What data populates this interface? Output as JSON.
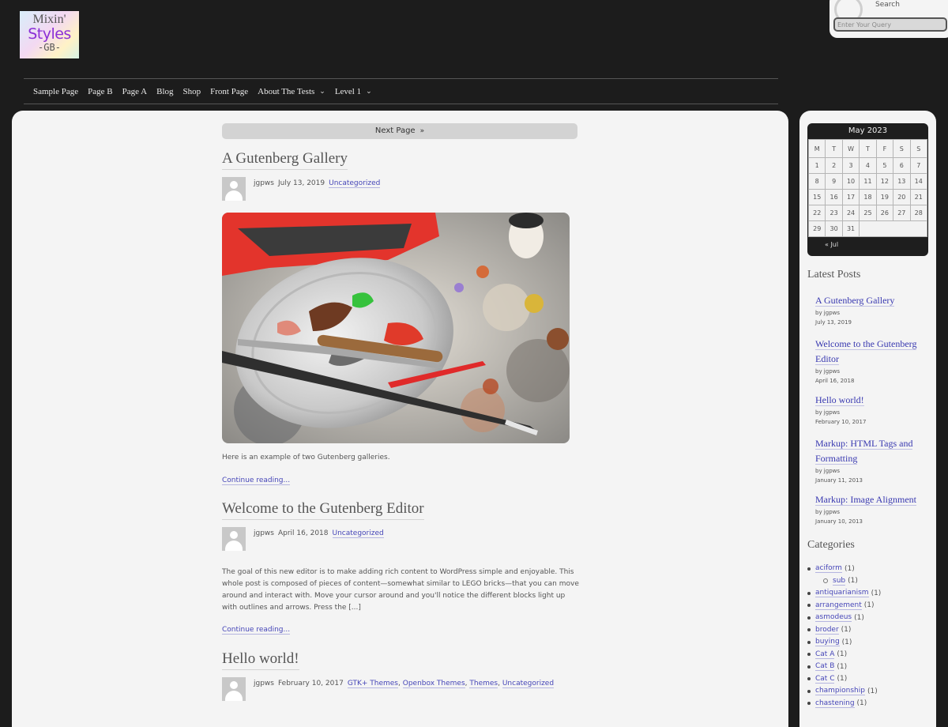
{
  "logo": {
    "line1": "Mixin'",
    "line2": "Styles",
    "line3": "-GB-"
  },
  "search": {
    "label": "Search",
    "placeholder": "Enter Your Query"
  },
  "nav": {
    "items": [
      "Sample Page",
      "Page B",
      "Page A",
      "Blog",
      "Shop",
      "Front Page",
      "About The Tests",
      "Level 1"
    ]
  },
  "pager": {
    "next_label": "Next Page",
    "next_icon": "»"
  },
  "posts": [
    {
      "title": "A Gutenberg Gallery",
      "author": "jgpws",
      "date": "July 13, 2019",
      "categories": [
        "Uncategorized"
      ],
      "excerpt": "Here is an example of two Gutenberg galleries.",
      "continue": "Continue reading..."
    },
    {
      "title": "Welcome to the Gutenberg Editor",
      "author": "jgpws",
      "date": "April 16, 2018",
      "categories": [
        "Uncategorized"
      ],
      "excerpt": "The goal of this new editor is to make adding rich content to WordPress simple and enjoyable. This whole post is composed of pieces of content—somewhat similar to LEGO bricks—that you can move around and interact with. Move your cursor around and you'll notice the different blocks light up with outlines and arrows. Press the [...]",
      "continue": "Continue reading..."
    },
    {
      "title": "Hello world!",
      "author": "jgpws",
      "date": "February 10, 2017",
      "categories": [
        "GTK+ Themes",
        "Openbox Themes",
        "Themes",
        "Uncategorized"
      ]
    }
  ],
  "calendar": {
    "caption": "May 2023",
    "days": [
      "M",
      "T",
      "W",
      "T",
      "F",
      "S",
      "S"
    ],
    "weeks": [
      [
        "1",
        "2",
        "3",
        "4",
        "5",
        "6",
        "7"
      ],
      [
        "8",
        "9",
        "10",
        "11",
        "12",
        "13",
        "14"
      ],
      [
        "15",
        "16",
        "17",
        "18",
        "19",
        "20",
        "21"
      ],
      [
        "22",
        "23",
        "24",
        "25",
        "26",
        "27",
        "28"
      ],
      [
        "29",
        "30",
        "31",
        "",
        "",
        "",
        ""
      ]
    ],
    "prev": "« Jul"
  },
  "latest_posts": {
    "title": "Latest Posts",
    "items": [
      {
        "title": "A Gutenberg Gallery",
        "by": "by jgpws",
        "date": "July 13, 2019"
      },
      {
        "title": "Welcome to the Gutenberg Editor",
        "by": "by jgpws",
        "date": "April 16, 2018"
      },
      {
        "title": "Hello world!",
        "by": "by jgpws",
        "date": "February 10, 2017"
      },
      {
        "title": "Markup: HTML Tags and Formatting",
        "by": "by jgpws",
        "date": "January 11, 2013"
      },
      {
        "title": "Markup: Image Alignment",
        "by": "by jgpws",
        "date": "January 10, 2013"
      }
    ]
  },
  "categories": {
    "title": "Categories",
    "items": [
      {
        "name": "aciform",
        "count": "(1)",
        "sub": false
      },
      {
        "name": "sub",
        "count": "(1)",
        "sub": true
      },
      {
        "name": "antiquarianism",
        "count": "(1)",
        "sub": false
      },
      {
        "name": "arrangement",
        "count": "(1)",
        "sub": false
      },
      {
        "name": "asmodeus",
        "count": "(1)",
        "sub": false
      },
      {
        "name": "broder",
        "count": "(1)",
        "sub": false
      },
      {
        "name": "buying",
        "count": "(1)",
        "sub": false
      },
      {
        "name": "Cat A",
        "count": "(1)",
        "sub": false
      },
      {
        "name": "Cat B",
        "count": "(1)",
        "sub": false
      },
      {
        "name": "Cat C",
        "count": "(1)",
        "sub": false
      },
      {
        "name": "championship",
        "count": "(1)",
        "sub": false
      },
      {
        "name": "chastening",
        "count": "(1)",
        "sub": false
      }
    ]
  }
}
